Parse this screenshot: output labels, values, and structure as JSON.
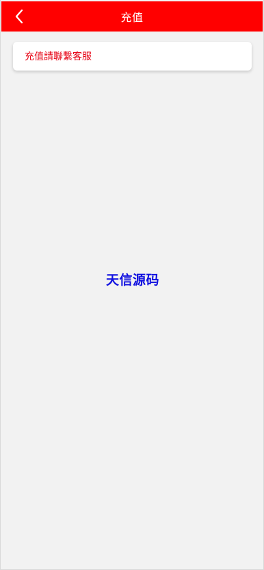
{
  "header": {
    "title": "充值",
    "back_icon": "chevron-left-icon",
    "background": "#ff0000"
  },
  "notice": {
    "text": "充值請聯繫客服",
    "color": "#e60012"
  },
  "watermark": {
    "text": "天信源码",
    "color": "#1010e0"
  }
}
